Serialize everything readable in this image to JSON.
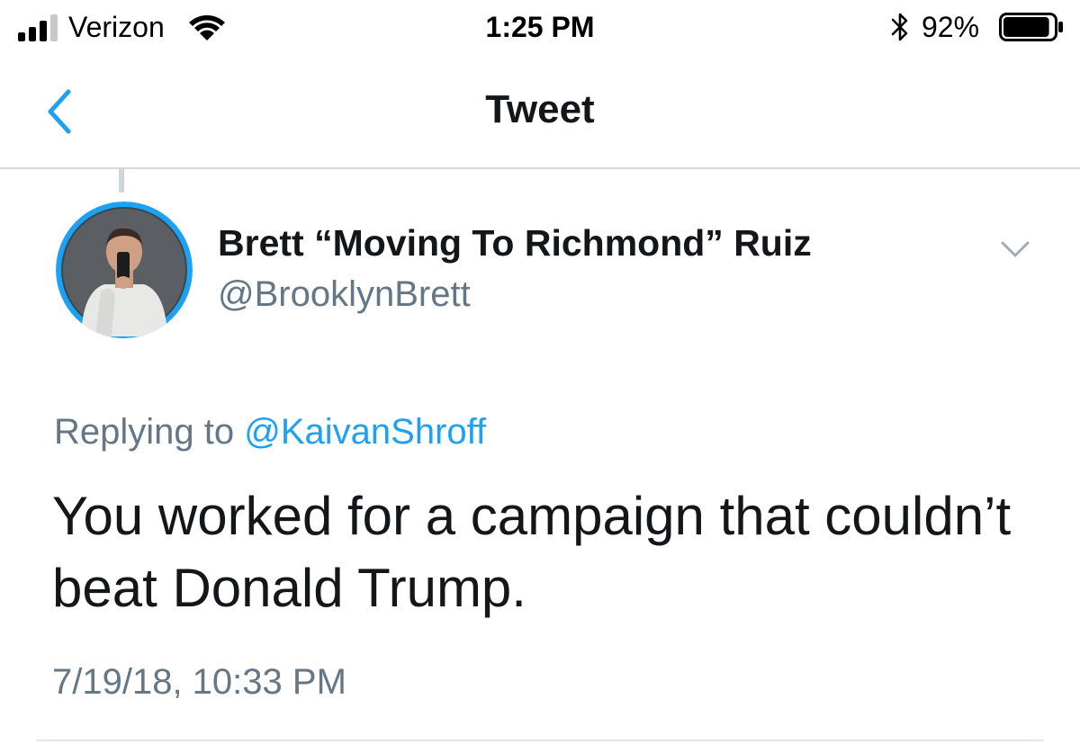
{
  "status_bar": {
    "carrier": "Verizon",
    "time": "1:25 PM",
    "battery_percent": "92%",
    "signal_bars_active": 3,
    "signal_bars_total": 4,
    "battery_level": 0.92,
    "icons": [
      "signal-icon",
      "wifi-icon",
      "bluetooth-icon",
      "battery-icon"
    ]
  },
  "nav": {
    "title": "Tweet",
    "back_icon": "chevron-left-icon"
  },
  "tweet": {
    "display_name": "Brett “Moving To Richmond” Ruiz",
    "handle": "@BrooklynBrett",
    "replying_prefix": "Replying to",
    "replying_to": "@KaivanShroff",
    "text": "You worked for a campaign that couldn’t beat Donald Trump.",
    "timestamp": "7/19/18, 10:33 PM",
    "more_icon": "chevron-down-icon"
  },
  "colors": {
    "accent": "#1da1f2",
    "text_primary": "#14171a",
    "text_secondary": "#657786",
    "divider": "#d6d9dc",
    "avatar_ring": "#1da1f2"
  }
}
